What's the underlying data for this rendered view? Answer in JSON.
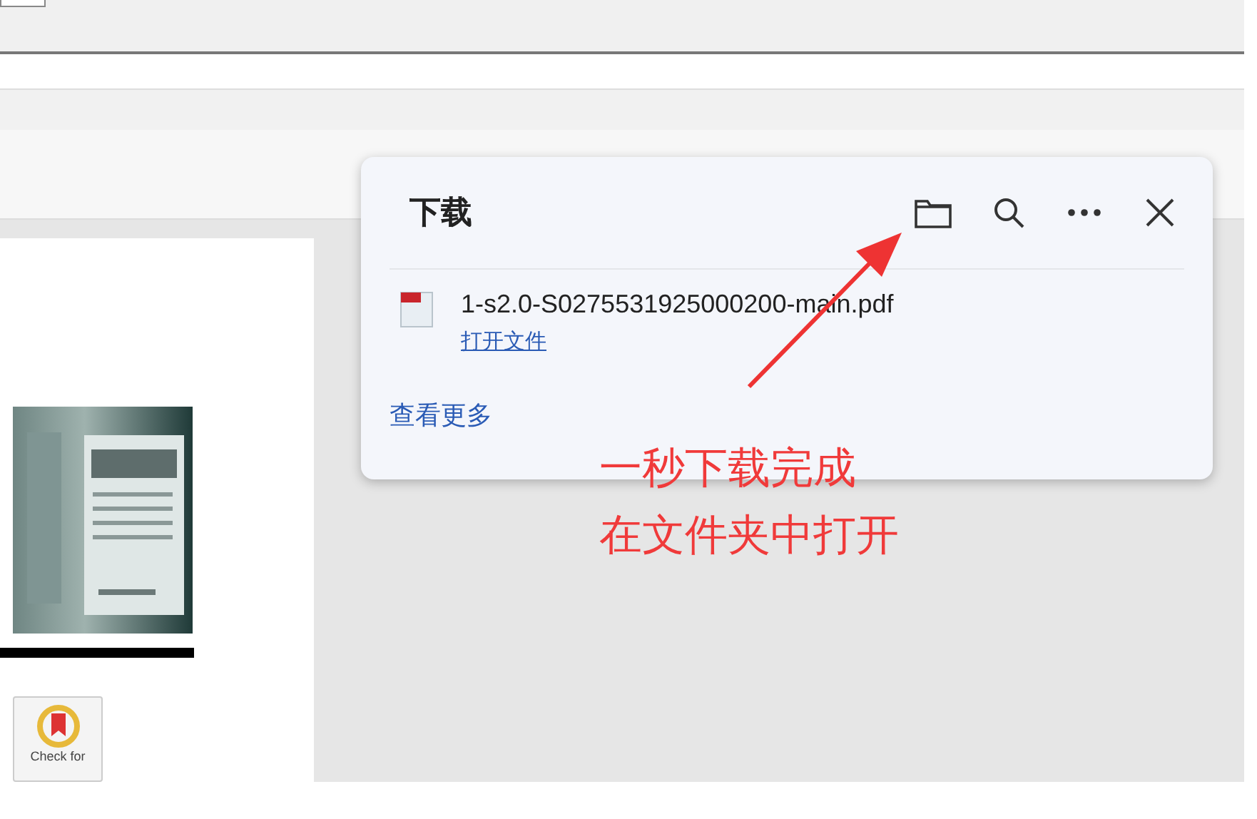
{
  "download_panel": {
    "title": "下载",
    "items": [
      {
        "file_name": "1-s2.0-S0275531925000200-main.pdf",
        "action": "打开文件"
      }
    ],
    "more_link": "查看更多"
  },
  "pdf_page": {
    "badge_text": "Check for"
  },
  "annotation": {
    "lines": [
      "一秒下载完成",
      "在文件夹中打开"
    ]
  }
}
